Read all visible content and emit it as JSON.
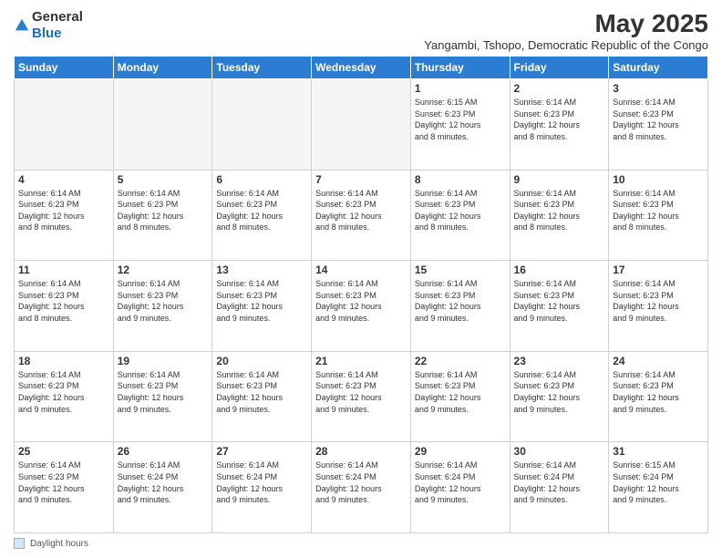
{
  "logo": {
    "general": "General",
    "blue": "Blue"
  },
  "header": {
    "month": "May 2025",
    "location": "Yangambi, Tshopo, Democratic Republic of the Congo"
  },
  "weekdays": [
    "Sunday",
    "Monday",
    "Tuesday",
    "Wednesday",
    "Thursday",
    "Friday",
    "Saturday"
  ],
  "footer": {
    "label": "Daylight hours"
  },
  "weeks": [
    [
      {
        "day": "",
        "info": ""
      },
      {
        "day": "",
        "info": ""
      },
      {
        "day": "",
        "info": ""
      },
      {
        "day": "",
        "info": ""
      },
      {
        "day": "1",
        "info": "Sunrise: 6:15 AM\nSunset: 6:23 PM\nDaylight: 12 hours\nand 8 minutes."
      },
      {
        "day": "2",
        "info": "Sunrise: 6:14 AM\nSunset: 6:23 PM\nDaylight: 12 hours\nand 8 minutes."
      },
      {
        "day": "3",
        "info": "Sunrise: 6:14 AM\nSunset: 6:23 PM\nDaylight: 12 hours\nand 8 minutes."
      }
    ],
    [
      {
        "day": "4",
        "info": "Sunrise: 6:14 AM\nSunset: 6:23 PM\nDaylight: 12 hours\nand 8 minutes."
      },
      {
        "day": "5",
        "info": "Sunrise: 6:14 AM\nSunset: 6:23 PM\nDaylight: 12 hours\nand 8 minutes."
      },
      {
        "day": "6",
        "info": "Sunrise: 6:14 AM\nSunset: 6:23 PM\nDaylight: 12 hours\nand 8 minutes."
      },
      {
        "day": "7",
        "info": "Sunrise: 6:14 AM\nSunset: 6:23 PM\nDaylight: 12 hours\nand 8 minutes."
      },
      {
        "day": "8",
        "info": "Sunrise: 6:14 AM\nSunset: 6:23 PM\nDaylight: 12 hours\nand 8 minutes."
      },
      {
        "day": "9",
        "info": "Sunrise: 6:14 AM\nSunset: 6:23 PM\nDaylight: 12 hours\nand 8 minutes."
      },
      {
        "day": "10",
        "info": "Sunrise: 6:14 AM\nSunset: 6:23 PM\nDaylight: 12 hours\nand 8 minutes."
      }
    ],
    [
      {
        "day": "11",
        "info": "Sunrise: 6:14 AM\nSunset: 6:23 PM\nDaylight: 12 hours\nand 8 minutes."
      },
      {
        "day": "12",
        "info": "Sunrise: 6:14 AM\nSunset: 6:23 PM\nDaylight: 12 hours\nand 9 minutes."
      },
      {
        "day": "13",
        "info": "Sunrise: 6:14 AM\nSunset: 6:23 PM\nDaylight: 12 hours\nand 9 minutes."
      },
      {
        "day": "14",
        "info": "Sunrise: 6:14 AM\nSunset: 6:23 PM\nDaylight: 12 hours\nand 9 minutes."
      },
      {
        "day": "15",
        "info": "Sunrise: 6:14 AM\nSunset: 6:23 PM\nDaylight: 12 hours\nand 9 minutes."
      },
      {
        "day": "16",
        "info": "Sunrise: 6:14 AM\nSunset: 6:23 PM\nDaylight: 12 hours\nand 9 minutes."
      },
      {
        "day": "17",
        "info": "Sunrise: 6:14 AM\nSunset: 6:23 PM\nDaylight: 12 hours\nand 9 minutes."
      }
    ],
    [
      {
        "day": "18",
        "info": "Sunrise: 6:14 AM\nSunset: 6:23 PM\nDaylight: 12 hours\nand 9 minutes."
      },
      {
        "day": "19",
        "info": "Sunrise: 6:14 AM\nSunset: 6:23 PM\nDaylight: 12 hours\nand 9 minutes."
      },
      {
        "day": "20",
        "info": "Sunrise: 6:14 AM\nSunset: 6:23 PM\nDaylight: 12 hours\nand 9 minutes."
      },
      {
        "day": "21",
        "info": "Sunrise: 6:14 AM\nSunset: 6:23 PM\nDaylight: 12 hours\nand 9 minutes."
      },
      {
        "day": "22",
        "info": "Sunrise: 6:14 AM\nSunset: 6:23 PM\nDaylight: 12 hours\nand 9 minutes."
      },
      {
        "day": "23",
        "info": "Sunrise: 6:14 AM\nSunset: 6:23 PM\nDaylight: 12 hours\nand 9 minutes."
      },
      {
        "day": "24",
        "info": "Sunrise: 6:14 AM\nSunset: 6:23 PM\nDaylight: 12 hours\nand 9 minutes."
      }
    ],
    [
      {
        "day": "25",
        "info": "Sunrise: 6:14 AM\nSunset: 6:23 PM\nDaylight: 12 hours\nand 9 minutes."
      },
      {
        "day": "26",
        "info": "Sunrise: 6:14 AM\nSunset: 6:24 PM\nDaylight: 12 hours\nand 9 minutes."
      },
      {
        "day": "27",
        "info": "Sunrise: 6:14 AM\nSunset: 6:24 PM\nDaylight: 12 hours\nand 9 minutes."
      },
      {
        "day": "28",
        "info": "Sunrise: 6:14 AM\nSunset: 6:24 PM\nDaylight: 12 hours\nand 9 minutes."
      },
      {
        "day": "29",
        "info": "Sunrise: 6:14 AM\nSunset: 6:24 PM\nDaylight: 12 hours\nand 9 minutes."
      },
      {
        "day": "30",
        "info": "Sunrise: 6:14 AM\nSunset: 6:24 PM\nDaylight: 12 hours\nand 9 minutes."
      },
      {
        "day": "31",
        "info": "Sunrise: 6:15 AM\nSunset: 6:24 PM\nDaylight: 12 hours\nand 9 minutes."
      }
    ]
  ]
}
